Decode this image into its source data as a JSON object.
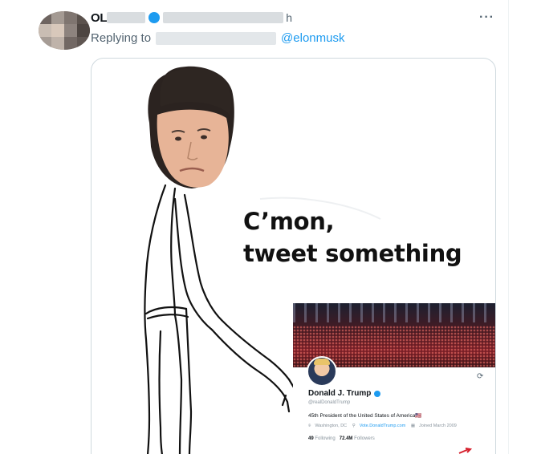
{
  "tweet": {
    "display_name": "OL",
    "handle_tail": "h",
    "more_label": "···",
    "replying_prefix": "Replying to",
    "mention": "@elonmusk"
  },
  "meme": {
    "caption_line1": "C’mon,",
    "caption_line2": "tweet something"
  },
  "profile_card": {
    "name": "Donald J. Trump",
    "handle": "@realDonaldTrump",
    "bio": "45th President of the United States of America🇺🇸",
    "location": "Washington, DC",
    "website": "Vote.DonaldTrump.com",
    "joined": "Joined March 2009",
    "following_count": "49",
    "following_label": "Following",
    "followers_count": "72.4M",
    "followers_label": "Followers"
  },
  "colors": {
    "accent": "#1d9bf0",
    "secondary_text": "#536471",
    "border": "#cfd9de"
  },
  "icons": [
    "more-icon",
    "verified-icon",
    "location-icon",
    "link-icon",
    "calendar-icon",
    "refresh-icon"
  ]
}
